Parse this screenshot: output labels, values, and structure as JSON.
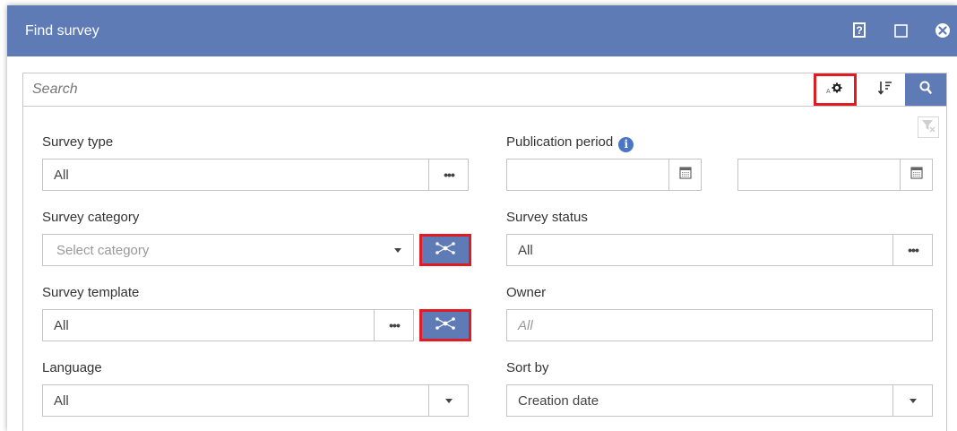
{
  "window": {
    "title": "Find survey",
    "accent": "#5f7bb6",
    "highlight": "#e01b24",
    "controls": [
      "help-icon",
      "maximize-icon",
      "close-icon"
    ]
  },
  "search": {
    "placeholder": "Search",
    "value": "",
    "actions": [
      "advanced-settings-icon",
      "sort-order-icon",
      "search-icon"
    ]
  },
  "filters": {
    "survey_type": {
      "label": "Survey type",
      "value": "All"
    },
    "survey_category": {
      "label": "Survey category",
      "placeholder": "Select category"
    },
    "survey_template": {
      "label": "Survey template",
      "value": "All"
    },
    "language": {
      "label": "Language",
      "value": "All"
    },
    "publication_period": {
      "label": "Publication period",
      "from": "",
      "to": ""
    },
    "survey_status": {
      "label": "Survey status",
      "value": "All"
    },
    "owner": {
      "label": "Owner",
      "placeholder": "All"
    },
    "sort_by": {
      "label": "Sort by",
      "value": "Creation date"
    }
  }
}
